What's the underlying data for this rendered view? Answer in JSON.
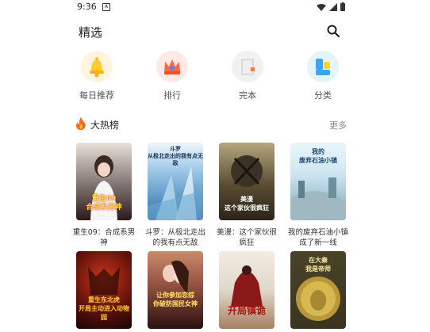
{
  "status": {
    "time": "9:36"
  },
  "header": {
    "title": "精选"
  },
  "categories": [
    {
      "label": "每日推荐",
      "icon": "bell-icon"
    },
    {
      "label": "排行",
      "icon": "crown-icon"
    },
    {
      "label": "完本",
      "icon": "book-icon"
    },
    {
      "label": "分类",
      "icon": "grid-icon"
    }
  ],
  "section": {
    "title": "大热榜",
    "more": "更多"
  },
  "books": [
    {
      "name": "重生09：合成系男神",
      "cover_text": "重生09\n合成系男神",
      "colors": [
        "#e8e0d8",
        "#2a1a1a"
      ],
      "text_color": "#ffe14a"
    },
    {
      "name": "斗罗：从极北走出的我有点无敌",
      "cover_text": "斗罗\n从极北走出的我有点无敌",
      "colors": [
        "#9ec9e8",
        "#2b6fa8"
      ],
      "text_color": "#1a3355"
    },
    {
      "name": "美漫：这个家伙很疯狂",
      "cover_text": "美漫\n这个家伙很疯狂",
      "colors": [
        "#8a7a5a",
        "#2a2418"
      ],
      "text_color": "#ffffff"
    },
    {
      "name": "我的废弃石油小镇成了新一线",
      "cover_text": "我的\n废弃石油小镇",
      "colors": [
        "#cfe6f2",
        "#7aa3b5"
      ],
      "text_color": "#1a4a78"
    },
    {
      "name": "",
      "cover_text": "重生东北虎\n开局主动进入动物园",
      "colors": [
        "#5a0f0a",
        "#1a0505"
      ],
      "text_color": "#ffcc33"
    },
    {
      "name": "",
      "cover_text": "让你参加恋综\n你破防国民女神",
      "colors": [
        "#8a4a3a",
        "#2a1010"
      ],
      "text_color": "#ffe36a"
    },
    {
      "name": "",
      "cover_text": "开局镇诡",
      "colors": [
        "#e0d8cc",
        "#8a1a1a"
      ],
      "text_color": "#b01010"
    },
    {
      "name": "",
      "cover_text": "在大秦\n我是帝师",
      "colors": [
        "#3a3420",
        "#a08a40"
      ],
      "text_color": "#f5e6a0"
    }
  ]
}
